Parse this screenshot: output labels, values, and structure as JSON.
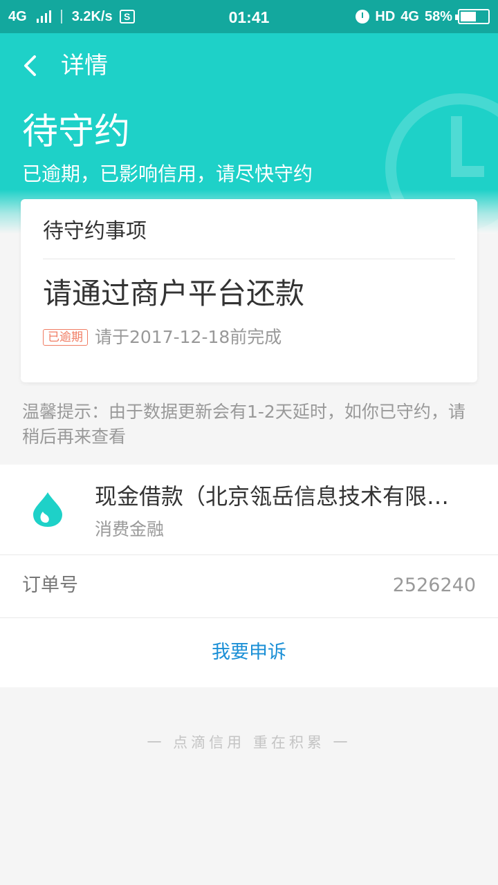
{
  "status_bar": {
    "network": "4G",
    "speed": "3.2K/s",
    "s_icon": "S",
    "time": "01:41",
    "hd": "HD",
    "network_right": "4G",
    "battery_percent": "58%",
    "battery_level": 0.58
  },
  "nav": {
    "title": "详情",
    "back_icon": "chevron-left-icon"
  },
  "status": {
    "title": "待守约",
    "subtitle": "已逾期，已影响信用，请尽快守约"
  },
  "card": {
    "title": "待守约事项",
    "main": "请通过商户平台还款",
    "badge": "已逾期",
    "due_text": "请于2017-12-18前完成"
  },
  "tip": "温馨提示：由于数据更新会有1-2天延时，如你已守约，请稍后再来查看",
  "merchant": {
    "name": "现金借款（北京瓴岳信息技术有限…",
    "type": "消费金融",
    "logo_icon": "water-drop-icon"
  },
  "order": {
    "label": "订单号",
    "value": "2526240"
  },
  "appeal": {
    "label": "我要申诉"
  },
  "footer": {
    "slogan": "一 点滴信用 重在积累 一"
  },
  "colors": {
    "status_bar": "#13a89e",
    "header": "#1ed1c8",
    "badge": "#f07c63",
    "link": "#1a8fd6"
  }
}
